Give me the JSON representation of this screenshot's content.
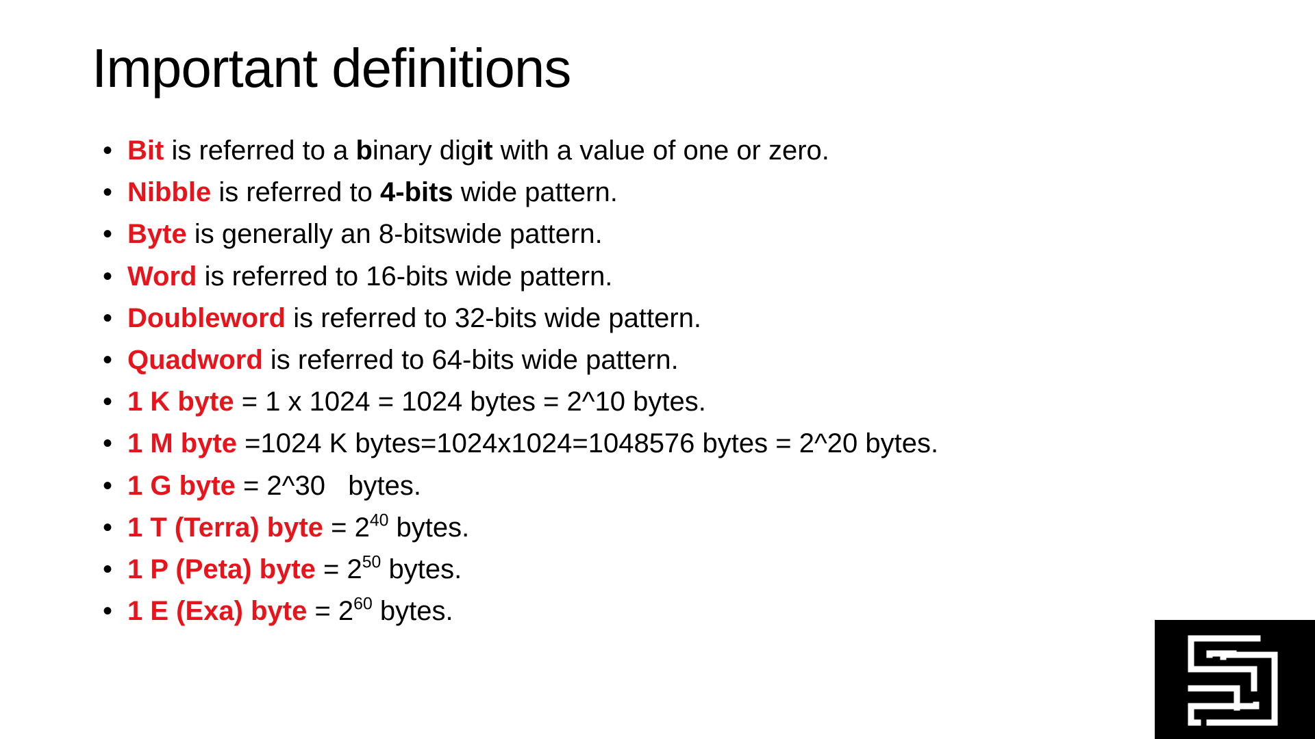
{
  "title": "Important definitions",
  "bullet_glyph": "•",
  "items": [
    {
      "term": "Bit",
      "text_1": " is referred to a ",
      "bold_1": "b",
      "text_2": "inary dig",
      "bold_2": "it",
      "text_3": " with a value of one or zero."
    },
    {
      "term": "Nibble",
      "text_1": " is referred to ",
      "bold_1": "4-bits",
      "text_2": " wide pattern."
    },
    {
      "term": "Byte",
      "text_1": " is generally an 8-bitswide pattern."
    },
    {
      "term": "Word",
      "text_1": " is referred to 16-bits wide pattern."
    },
    {
      "term": "Doubleword",
      "text_1": " is referred to 32-bits wide pattern."
    },
    {
      "term": "Quadword",
      "text_1": " is referred to 64-bits wide pattern."
    },
    {
      "term": "1 K byte",
      "text_1": " = 1 x 1024 = 1024 bytes = 2^10 bytes."
    },
    {
      "term": "1 M byte",
      "text_1": " =1024 K bytes=1024x1024=1048576 bytes = 2^20 bytes."
    },
    {
      "term": "1 G byte",
      "text_1": " = 2^30   bytes."
    },
    {
      "term": "1 T (Terra) byte",
      "text_1": " = 2",
      "exponent": "40",
      "text_2": " bytes."
    },
    {
      "term": "1 P (Peta) byte",
      "text_1": " = 2",
      "exponent": "50",
      "text_2": " bytes."
    },
    {
      "term": "1 E (Exa) byte",
      "text_1": " = 2",
      "exponent": "60",
      "text_2": " bytes."
    }
  ],
  "colors": {
    "term": "#e8141b",
    "text": "#000000",
    "background": "#ffffff",
    "logo_background": "#000000",
    "logo_mark": "#ffffff"
  },
  "logo": {
    "icon": "channel-logo-icon"
  }
}
